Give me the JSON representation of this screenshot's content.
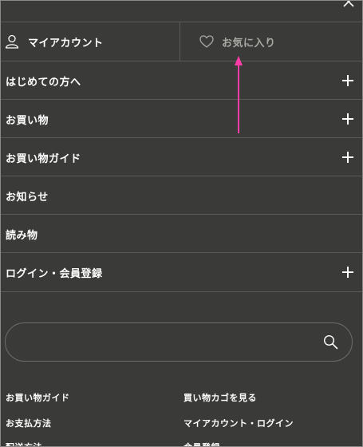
{
  "header": {
    "account_label": "マイアカウント",
    "account_icon": "user-icon",
    "favorites_label": "お気に入り",
    "favorites_icon": "heart-icon",
    "close_icon": "close-icon"
  },
  "menu": {
    "items": [
      {
        "label": "はじめての方へ",
        "expandable": true
      },
      {
        "label": "お買い物",
        "expandable": true
      },
      {
        "label": "お買い物ガイド",
        "expandable": true
      },
      {
        "label": "お知らせ",
        "expandable": false
      },
      {
        "label": "読み物",
        "expandable": false
      },
      {
        "label": "ログイン・会員登録",
        "expandable": true
      }
    ]
  },
  "search": {
    "placeholder": "",
    "icon": "search-icon"
  },
  "footer_links": {
    "left": [
      "お買い物ガイド",
      "お支払方法",
      "配送方法"
    ],
    "right": [
      "買い物カゴを見る",
      "マイアカウント・ログイン",
      "会員登録"
    ]
  },
  "annotation": {
    "color": "#ff3ca8"
  }
}
